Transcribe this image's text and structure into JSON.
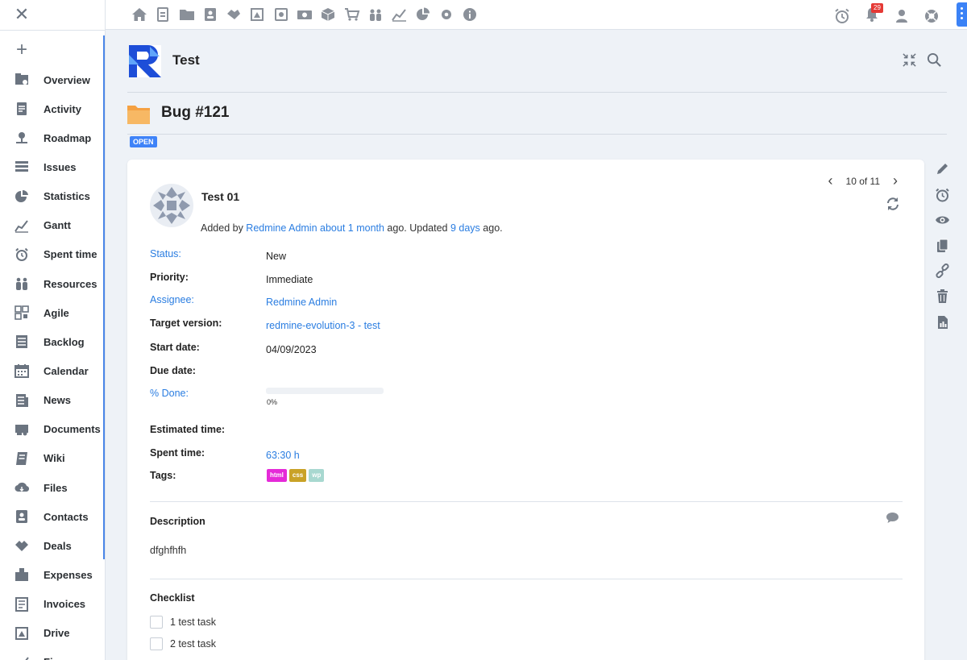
{
  "sidebar": {
    "items": [
      {
        "label": "Overview",
        "icon": "overview-icon"
      },
      {
        "label": "Activity",
        "icon": "activity-icon"
      },
      {
        "label": "Roadmap",
        "icon": "roadmap-icon"
      },
      {
        "label": "Issues",
        "icon": "issues-icon"
      },
      {
        "label": "Statistics",
        "icon": "statistics-icon"
      },
      {
        "label": "Gantt",
        "icon": "gantt-icon"
      },
      {
        "label": "Spent time",
        "icon": "alarm-clock-icon"
      },
      {
        "label": "Resources",
        "icon": "resources-icon"
      },
      {
        "label": "Agile",
        "icon": "agile-icon"
      },
      {
        "label": "Backlog",
        "icon": "backlog-icon"
      },
      {
        "label": "Calendar",
        "icon": "calendar-icon"
      },
      {
        "label": "News",
        "icon": "news-icon"
      },
      {
        "label": "Documents",
        "icon": "documents-icon"
      },
      {
        "label": "Wiki",
        "icon": "wiki-icon"
      },
      {
        "label": "Files",
        "icon": "files-icon"
      },
      {
        "label": "Contacts",
        "icon": "contacts-icon"
      },
      {
        "label": "Deals",
        "icon": "deals-icon"
      },
      {
        "label": "Expenses",
        "icon": "expenses-icon"
      },
      {
        "label": "Invoices",
        "icon": "invoices-icon"
      },
      {
        "label": "Drive",
        "icon": "drive-icon"
      },
      {
        "label": "Finance",
        "icon": "finance-icon"
      }
    ]
  },
  "topbar": {
    "notification_count": "29"
  },
  "project": {
    "title": "Test"
  },
  "issue": {
    "title": "Bug #121",
    "status_badge": "OPEN",
    "pager": "10 of 11",
    "subject": "Test 01",
    "meta": {
      "added_by_prefix": "Added by ",
      "author": "Redmine Admin",
      "created": "about 1 month",
      "mid": " ago. Updated ",
      "updated": "9 days",
      "suffix": " ago."
    },
    "attributes": {
      "status_label": "Status:",
      "status_value": "New",
      "priority_label": "Priority:",
      "priority_value": "Immediate",
      "assignee_label": "Assignee:",
      "assignee_value": "Redmine Admin",
      "target_version_label": "Target version:",
      "target_version_value": "redmine-evolution-3 - test",
      "start_date_label": "Start date:",
      "start_date_value": "04/09/2023",
      "due_date_label": "Due date:",
      "done_label": "% Done:",
      "done_value": "0%",
      "done_fraction": 0,
      "estimated_label": "Estimated time:",
      "spent_label": "Spent time:",
      "spent_value": "63:30 h",
      "tags_label": "Tags:"
    },
    "tags": [
      {
        "label": "html",
        "color": "#e52ad8"
      },
      {
        "label": "css",
        "color": "#c9a227"
      },
      {
        "label": "wp",
        "color": "#a8d8d0"
      }
    ],
    "description_title": "Description",
    "description": "dfghfhfh",
    "checklist_title": "Checklist",
    "checklist": [
      {
        "label": "1 test task",
        "done": false
      },
      {
        "label": "2 test task",
        "done": false
      }
    ]
  },
  "colors": {
    "accent": "#3f83f8",
    "link": "#2a7de1",
    "badge_red": "#e53935"
  }
}
